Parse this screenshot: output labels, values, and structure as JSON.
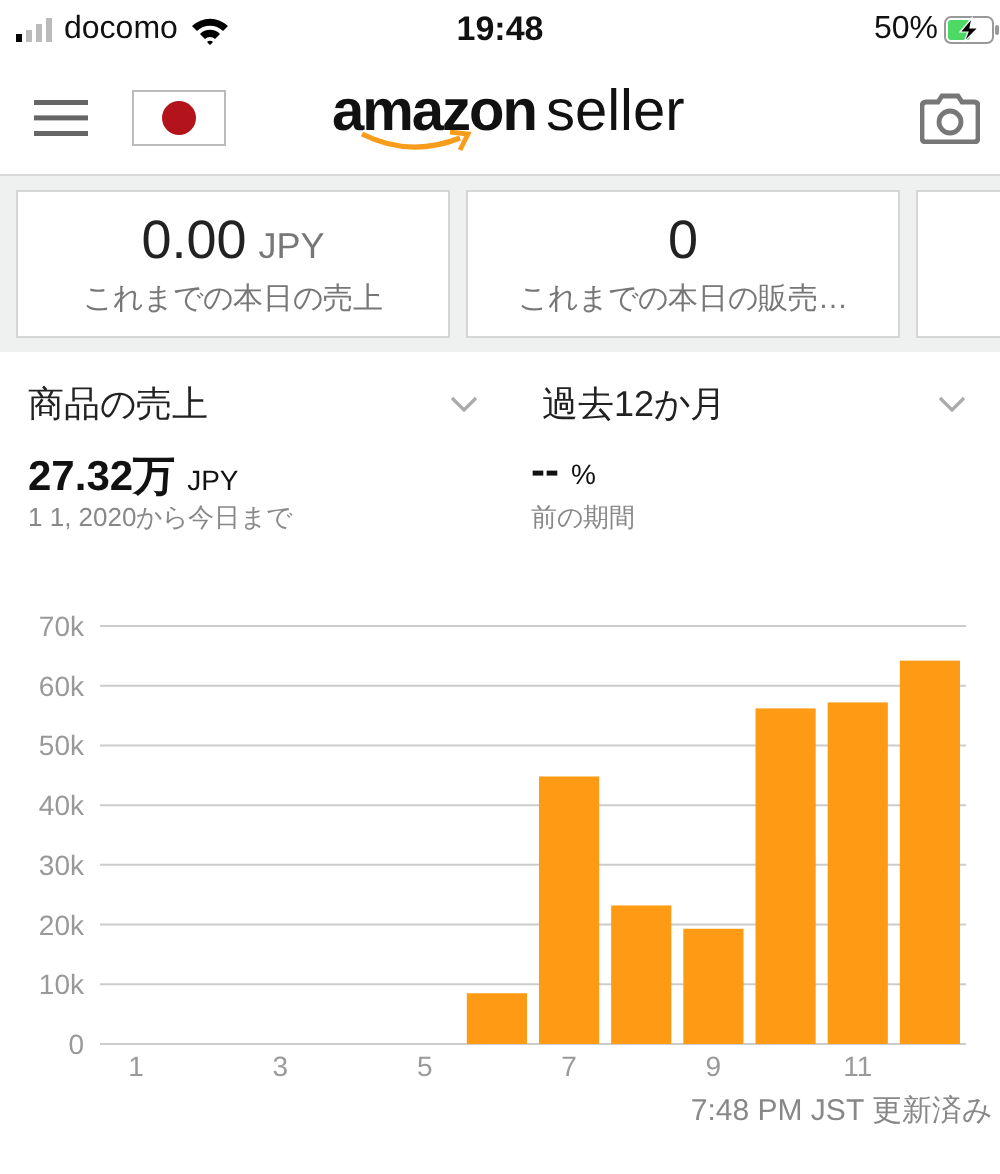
{
  "status_bar": {
    "carrier": "docomo",
    "time": "19:48",
    "battery": "50%"
  },
  "header": {
    "logo_brand": "amazon",
    "logo_product": "seller"
  },
  "cards": [
    {
      "value": "0.00",
      "unit": "JPY",
      "label": "これまでの本日の売上"
    },
    {
      "value": "0",
      "label": "これまでの本日の販売…"
    }
  ],
  "next_card_peek": true,
  "filters": [
    {
      "label": "商品の売上"
    },
    {
      "label": "過去12か月"
    }
  ],
  "metrics": [
    {
      "value": "27.32万",
      "unit": "JPY",
      "caption": "1 1, 2020から今日まで"
    },
    {
      "value": "--",
      "unit": "%",
      "caption": "前の期間"
    }
  ],
  "chart_data": {
    "type": "bar",
    "x": [
      1,
      2,
      3,
      4,
      5,
      6,
      7,
      8,
      9,
      10,
      11,
      12
    ],
    "series": [
      {
        "color": "#fe9a14",
        "values": [
          0,
          0,
          0,
          0,
          0,
          8500,
          44800,
          23200,
          19300,
          56200,
          57200,
          64200
        ]
      }
    ],
    "xlim": [
      0.5,
      12.5
    ],
    "ylim": [
      0,
      70000
    ],
    "grid": true,
    "yticks": [
      {
        "value": 0,
        "label": "0"
      },
      {
        "value": 10000,
        "label": "10k"
      },
      {
        "value": 20000,
        "label": "20k"
      },
      {
        "value": 30000,
        "label": "30k"
      },
      {
        "value": 40000,
        "label": "40k"
      },
      {
        "value": 50000,
        "label": "50k"
      },
      {
        "value": 60000,
        "label": "60k"
      },
      {
        "value": 70000,
        "label": "70k"
      }
    ],
    "xticks": [
      1,
      3,
      5,
      7,
      9,
      11
    ]
  },
  "updated": "7:48 PM JST 更新済み"
}
